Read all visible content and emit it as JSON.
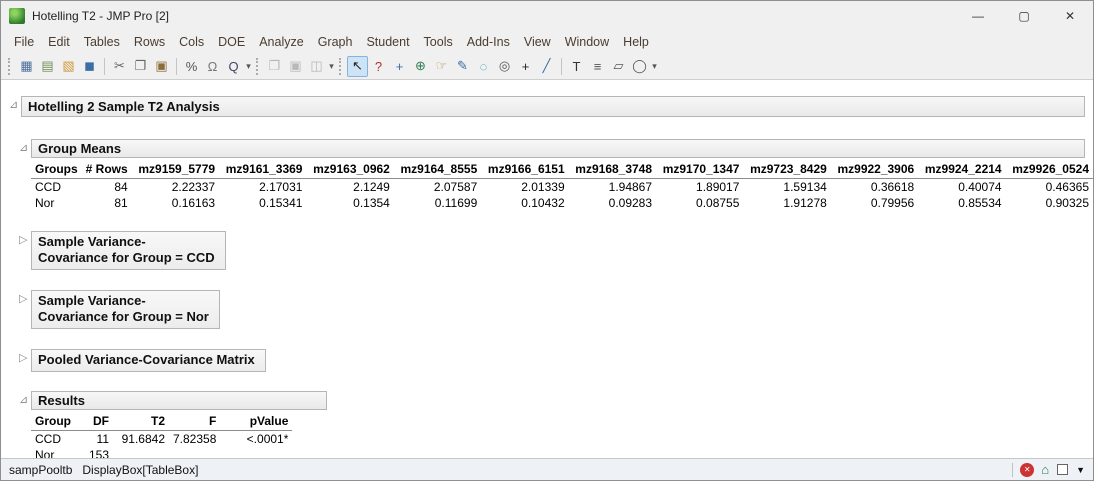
{
  "window": {
    "title": "Hotelling T2 - JMP Pro [2]",
    "controls": {
      "minimize": "—",
      "maximize": "▢",
      "close": "✕"
    }
  },
  "menu": {
    "items": [
      "File",
      "Edit",
      "Tables",
      "Rows",
      "Cols",
      "DOE",
      "Analyze",
      "Graph",
      "Student",
      "Tools",
      "Add-Ins",
      "View",
      "Window",
      "Help"
    ]
  },
  "toolbar": {
    "dropdown": "▾",
    "icons": [
      {
        "name": "new-data-table",
        "glyph": "▦",
        "color": "#4a6d9c"
      },
      {
        "name": "new-journal",
        "glyph": "▤",
        "color": "#6f8f57"
      },
      {
        "name": "open",
        "glyph": "▧",
        "color": "#d09a3e"
      },
      {
        "name": "save",
        "glyph": "◼",
        "color": "#3a6ea5"
      },
      {
        "name": "cut",
        "glyph": "✂",
        "color": "#666666"
      },
      {
        "name": "copy",
        "glyph": "❐",
        "color": "#666666"
      },
      {
        "name": "paste",
        "glyph": "▣",
        "color": "#8a6d3b"
      },
      {
        "name": "properties",
        "glyph": "%",
        "color": "#555555"
      },
      {
        "name": "lock",
        "glyph": "Ω",
        "color": "#777777"
      },
      {
        "name": "search",
        "glyph": "Q",
        "color": "#444466"
      },
      {
        "name": "paste-special",
        "glyph": "❐",
        "color": "#b8b8b8"
      },
      {
        "name": "copy-picture",
        "glyph": "▣",
        "color": "#b8b8b8"
      },
      {
        "name": "import",
        "glyph": "◫",
        "color": "#b8b8b8"
      },
      {
        "name": "arrow-tool",
        "glyph": "↖",
        "color": "#222222"
      },
      {
        "name": "help-tool",
        "glyph": "?",
        "color": "#b03030"
      },
      {
        "name": "crosshair-tool",
        "glyph": "+",
        "color": "#3a6ea5"
      },
      {
        "name": "globe-tool",
        "glyph": "⊕",
        "color": "#2e7d4f"
      },
      {
        "name": "grabber-tool",
        "glyph": "☞",
        "color": "#b8884a"
      },
      {
        "name": "brush-tool",
        "glyph": "✎",
        "color": "#3a6ea5"
      },
      {
        "name": "lasso-tool",
        "glyph": "◌",
        "color": "#2a8f8f"
      },
      {
        "name": "magnifier-tool",
        "glyph": "◎",
        "color": "#555555"
      },
      {
        "name": "plus-tool",
        "glyph": "+",
        "color": "#222222"
      },
      {
        "name": "scribble-tool",
        "glyph": "╱",
        "color": "#3a6ea5"
      },
      {
        "name": "annotate-tool",
        "glyph": "T",
        "color": "#333333"
      },
      {
        "name": "line-tool",
        "glyph": "≡",
        "color": "#555555"
      },
      {
        "name": "polygon-tool",
        "glyph": "▱",
        "color": "#555555"
      },
      {
        "name": "oval-tool",
        "glyph": "◯",
        "color": "#555555"
      }
    ]
  },
  "icons": {
    "open": "⊿",
    "collapsed": "▷"
  },
  "report": {
    "title": "Hotelling 2 Sample T2 Analysis",
    "group_means": {
      "title": "Group Means",
      "columns": [
        "Groups",
        "# Rows",
        "mz9159_5779",
        "mz9161_3369",
        "mz9163_0962",
        "mz9164_8555",
        "mz9166_6151",
        "mz9168_3748",
        "mz9170_1347",
        "mz9723_8429",
        "mz9922_3906",
        "mz9924_2214",
        "mz9926_0524"
      ],
      "rows": [
        [
          "CCD",
          "84",
          "2.22337",
          "2.17031",
          "2.1249",
          "2.07587",
          "2.01339",
          "1.94867",
          "1.89017",
          "1.59134",
          "0.36618",
          "0.40074",
          "0.46365"
        ],
        [
          "Nor",
          "81",
          "0.16163",
          "0.15341",
          "0.1354",
          "0.11699",
          "0.10432",
          "0.09283",
          "0.08755",
          "1.91278",
          "0.79956",
          "0.85534",
          "0.90325"
        ]
      ]
    },
    "collapsed_sections": [
      {
        "line1": "Sample Variance-",
        "line2": "Covariance for Group = CCD"
      },
      {
        "line1": "Sample Variance-",
        "line2": "Covariance for Group = Nor"
      }
    ],
    "pooled": {
      "title": "Pooled Variance-Covariance Matrix"
    },
    "results": {
      "title": "Results",
      "columns": [
        "Group",
        "DF",
        "T2",
        "F",
        "pValue"
      ],
      "rows": [
        [
          "CCD",
          "11",
          "91.6842",
          "7.82358",
          "<.0001*"
        ],
        [
          "Nor",
          "153",
          "",
          "",
          ""
        ]
      ]
    }
  },
  "statusbar": {
    "left": "sampPooltb",
    "box": "DisplayBox[TableBox]",
    "icons": {
      "error": "✕",
      "home": "⌂",
      "dropdown": "▼"
    },
    "colors": {
      "error_bg": "#cc3333",
      "home": "#2e7d4f"
    }
  }
}
